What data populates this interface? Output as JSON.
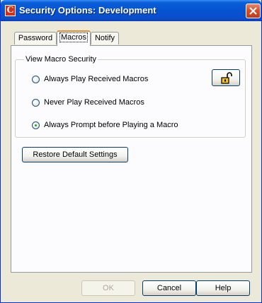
{
  "window": {
    "title": "Security Options: Development",
    "app_icon_letter": "C",
    "close_icon": "close-icon"
  },
  "tabs": [
    {
      "label": "Password",
      "active": false
    },
    {
      "label": "Macros",
      "active": true
    },
    {
      "label": "Notify",
      "active": false
    }
  ],
  "macro_security": {
    "legend": "View Macro Security",
    "options": [
      {
        "label": "Always Play Received Macros",
        "checked": false
      },
      {
        "label": "Never Play Received Macros",
        "checked": false
      },
      {
        "label": "Always Prompt before Playing a Macro",
        "checked": true
      }
    ],
    "lock_icon": "unlocked-padlock-icon"
  },
  "restore_button": "Restore Default Settings",
  "footer": {
    "ok": "OK",
    "ok_enabled": false,
    "cancel": "Cancel",
    "help": "Help"
  }
}
